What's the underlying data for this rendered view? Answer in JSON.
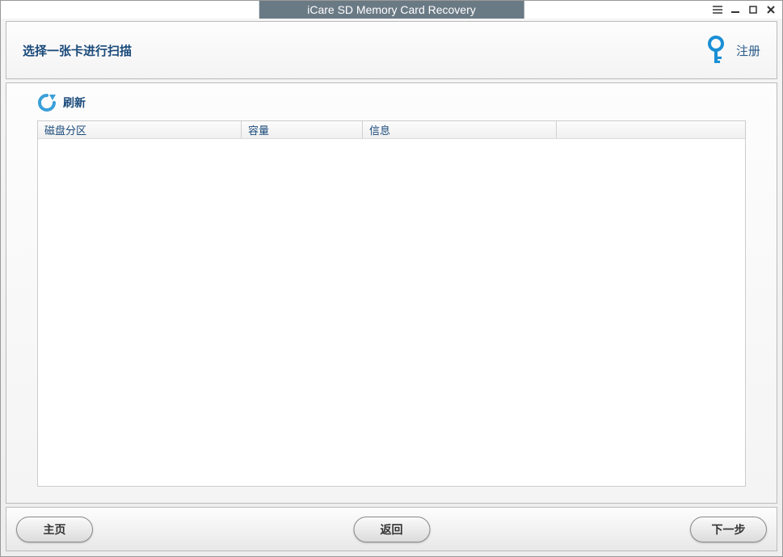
{
  "window": {
    "title": "iCare SD Memory Card Recovery"
  },
  "header": {
    "title": "选择一张卡进行扫描",
    "register_label": "注册"
  },
  "main": {
    "refresh_label": "刷新",
    "columns": {
      "partition": "磁盘分区",
      "capacity": "容量",
      "info": "信息",
      "extra": ""
    },
    "rows": []
  },
  "footer": {
    "home_label": "主页",
    "back_label": "返回",
    "next_label": "下一步"
  },
  "icons": {
    "refresh": "refresh-icon",
    "key": "key-icon",
    "menu": "menu-icon",
    "minimize": "minimize-icon",
    "maximize": "maximize-icon",
    "close": "close-icon"
  },
  "colors": {
    "title_bg": "#6a7a85",
    "accent": "#1a4a7a",
    "key_blue": "#1a8fd4"
  }
}
